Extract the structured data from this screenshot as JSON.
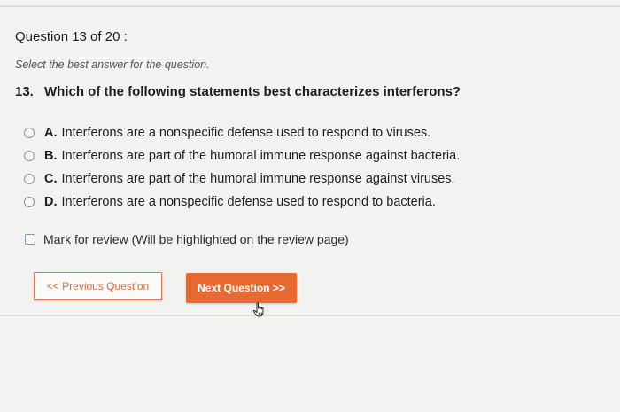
{
  "question": {
    "header": "Question 13 of 20 :",
    "instruction": "Select the best answer for the question.",
    "number": "13.",
    "text": "Which of the following statements best characterizes interferons?"
  },
  "options": [
    {
      "letter": "A.",
      "text": "Interferons are a nonspecific defense used to respond to viruses.",
      "selected": false
    },
    {
      "letter": "B.",
      "text": "Interferons are part of the humoral immune response against bacteria.",
      "selected": false
    },
    {
      "letter": "C.",
      "text": "Interferons are part of the humoral immune response against viruses.",
      "selected": false
    },
    {
      "letter": "D.",
      "text": "Interferons are a nonspecific defense used to respond to bacteria.",
      "selected": false
    }
  ],
  "mark_review": {
    "label": "Mark for review (Will be highlighted on the review page)",
    "checked": false
  },
  "navigation": {
    "prev_label": "<< Previous Question",
    "next_label": "Next Question >>"
  },
  "colors": {
    "accent": "#e86a33",
    "background": "#f2f2f0",
    "text": "#1e1e1e"
  },
  "icons": {
    "cursor": "hand-pointer-icon"
  }
}
